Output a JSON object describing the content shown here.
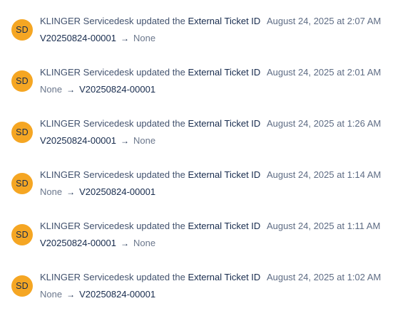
{
  "activity": [
    {
      "avatar_initials": "SD",
      "actor": "KLINGER Servicedesk",
      "verb": "updated the",
      "field": "External Ticket ID",
      "timestamp": "August 24, 2025 at 2:07 AM",
      "from": "V20250824-00001",
      "from_kind": "id",
      "arrow": "→",
      "to": "None",
      "to_kind": "none"
    },
    {
      "avatar_initials": "SD",
      "actor": "KLINGER Servicedesk",
      "verb": "updated the",
      "field": "External Ticket ID",
      "timestamp": "August 24, 2025 at 2:01 AM",
      "from": "None",
      "from_kind": "none",
      "arrow": "→",
      "to": "V20250824-00001",
      "to_kind": "id"
    },
    {
      "avatar_initials": "SD",
      "actor": "KLINGER Servicedesk",
      "verb": "updated the",
      "field": "External Ticket ID",
      "timestamp": "August 24, 2025 at 1:26 AM",
      "from": "V20250824-00001",
      "from_kind": "id",
      "arrow": "→",
      "to": "None",
      "to_kind": "none"
    },
    {
      "avatar_initials": "SD",
      "actor": "KLINGER Servicedesk",
      "verb": "updated the",
      "field": "External Ticket ID",
      "timestamp": "August 24, 2025 at 1:14 AM",
      "from": "None",
      "from_kind": "none",
      "arrow": "→",
      "to": "V20250824-00001",
      "to_kind": "id"
    },
    {
      "avatar_initials": "SD",
      "actor": "KLINGER Servicedesk",
      "verb": "updated the",
      "field": "External Ticket ID",
      "timestamp": "August 24, 2025 at 1:11 AM",
      "from": "V20250824-00001",
      "from_kind": "id",
      "arrow": "→",
      "to": "None",
      "to_kind": "none"
    },
    {
      "avatar_initials": "SD",
      "actor": "KLINGER Servicedesk",
      "verb": "updated the",
      "field": "External Ticket ID",
      "timestamp": "August 24, 2025 at 1:02 AM",
      "from": "None",
      "from_kind": "none",
      "arrow": "→",
      "to": "V20250824-00001",
      "to_kind": "id"
    }
  ],
  "colors": {
    "avatar_bg": "#f5a623",
    "text_primary": "#172b4d",
    "text_secondary": "#42526e",
    "text_muted": "#6b778c"
  }
}
